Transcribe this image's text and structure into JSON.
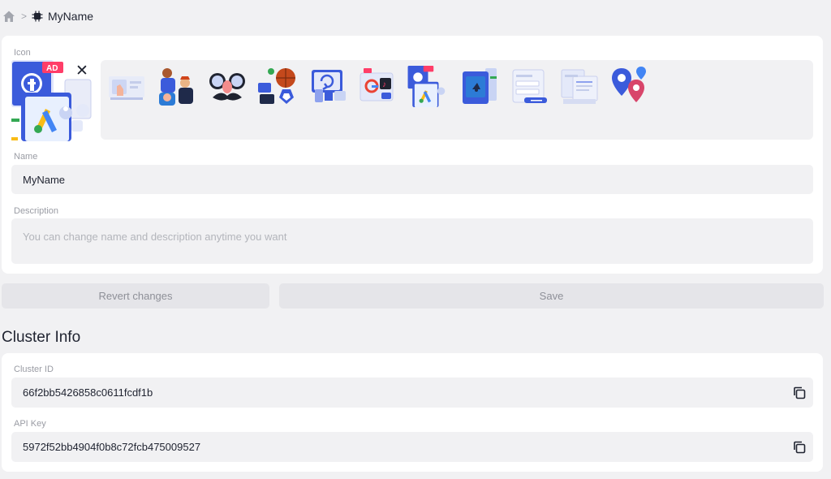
{
  "breadcrumb": {
    "home_icon": "home-icon",
    "separator": ">",
    "chip_icon": "chip-icon",
    "title": "MyName"
  },
  "form": {
    "icon_label": "Icon",
    "selected_icon": "facebook-google-ads-illustration",
    "icon_options": [
      "video-call-illustration",
      "team-people-illustration",
      "disguise-glasses-mustache-illustration",
      "sports-stats-illustration",
      "computer-sync-illustration",
      "media-apps-illustration",
      "facebook-google-ads-illustration",
      "phone-notification-illustration",
      "login-form-illustration",
      "documents-illustration",
      "map-pins-illustration"
    ],
    "name_label": "Name",
    "name_value": "MyName",
    "description_label": "Description",
    "description_placeholder": "You can change name and description anytime you want"
  },
  "actions": {
    "revert_label": "Revert changes",
    "save_label": "Save"
  },
  "cluster": {
    "title": "Cluster Info",
    "id_label": "Cluster ID",
    "id_value": "66f2bb5426858c0611fcdf1b",
    "key_label": "API Key",
    "key_value": "5972f52bb4904f0b8c72fcb475009527"
  },
  "colors": {
    "page_bg": "#f1f1f3",
    "card_bg": "#ffffff",
    "facebook_blue": "#3b5bdb",
    "ad_badge": "#ff3d68",
    "google_yellow": "#f9bc15",
    "google_blue": "#4285f4",
    "google_green": "#34a853"
  }
}
